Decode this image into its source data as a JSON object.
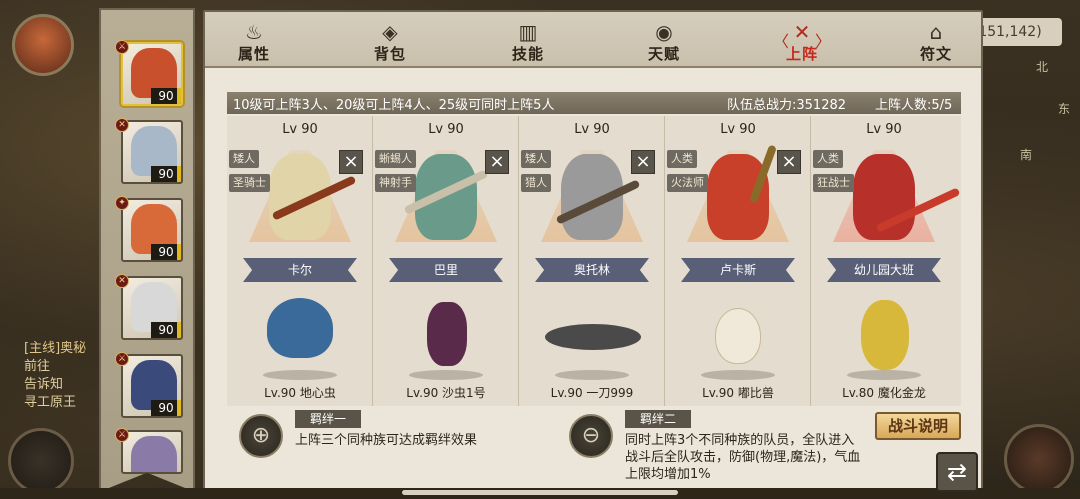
{
  "hud": {
    "coordinates": "151,142)",
    "compass": [
      "北",
      "东",
      "南"
    ],
    "quest_lines": [
      "[主线]奥秘",
      "前往",
      "告诉知",
      "寻工原王"
    ]
  },
  "tabs": [
    {
      "label": "属性",
      "icon": "flame-icon"
    },
    {
      "label": "背包",
      "icon": "bag-icon"
    },
    {
      "label": "技能",
      "icon": "book-icon"
    },
    {
      "label": "天赋",
      "icon": "eye-icon"
    },
    {
      "label": "上阵",
      "icon": "crossed-swords-icon",
      "active": true
    },
    {
      "label": "符文",
      "icon": "rune-icon"
    }
  ],
  "info": {
    "rule": "10级可上阵3人、20级可上阵4人、25级可同时上阵5人",
    "power": "队伍总战力:351282",
    "count": "上阵人数:5/5"
  },
  "roster": [
    {
      "level": "90",
      "color": "#c8502c",
      "active": true
    },
    {
      "level": "90",
      "color": "#a8b8c8"
    },
    {
      "level": "90",
      "color": "#d86a3a"
    },
    {
      "level": "90",
      "color": "#d8d8d8"
    },
    {
      "level": "90",
      "color": "#3a4a7a"
    },
    {
      "level": "",
      "color": "#8a7aa8"
    }
  ],
  "team": [
    {
      "lv": "Lv 90",
      "race": "矮人",
      "job": "圣骑士",
      "name": "卡尔",
      "removable": true,
      "body_color": "#e0d4a8",
      "weapon_color": "#8a3a1c",
      "pet": "Lv.90 地心虫",
      "pet_color": "#3a6a9a"
    },
    {
      "lv": "Lv 90",
      "race": "蜥蜴人",
      "job": "神射手",
      "name": "巴里",
      "removable": true,
      "body_color": "#6a9a8a",
      "weapon_color": "#c8c0a8",
      "pet": "Lv.90 沙虫1号",
      "pet_color": "#5a2a4a"
    },
    {
      "lv": "Lv 90",
      "race": "矮人",
      "job": "猎人",
      "name": "奥托林",
      "removable": true,
      "body_color": "#9a9a9a",
      "weapon_color": "#5a4a3a",
      "pet": "Lv.90 一刀999",
      "pet_color": "#4a4a4a"
    },
    {
      "lv": "Lv 90",
      "race": "人类",
      "job": "火法师",
      "name": "卢卡斯",
      "removable": true,
      "body_color": "#c8402a",
      "weapon_color": "#8a6a2a",
      "pet": "Lv.90 嘟比兽",
      "pet_color": "#f0e8d8"
    },
    {
      "lv": "Lv 90",
      "race": "人类",
      "job": "狂战士",
      "name": "幼儿园大班",
      "removable": false,
      "body_color": "#b8302a",
      "weapon_color": "#c83a2a",
      "pet": "Lv.80 魔化金龙",
      "pet_color": "#d8b83a"
    }
  ],
  "bonds": [
    {
      "title": "羁绊一",
      "desc": [
        "上阵三个同种族可达成羁绊效果"
      ]
    },
    {
      "title": "羁绊二",
      "desc": [
        "同时上阵3个不同种族的队员，全队进入",
        "战斗后全队攻击，防御(物理,魔法)，气血",
        "上限均增加1%"
      ]
    }
  ],
  "buttons": {
    "battle_info": "战斗说明",
    "return": "⇄"
  }
}
